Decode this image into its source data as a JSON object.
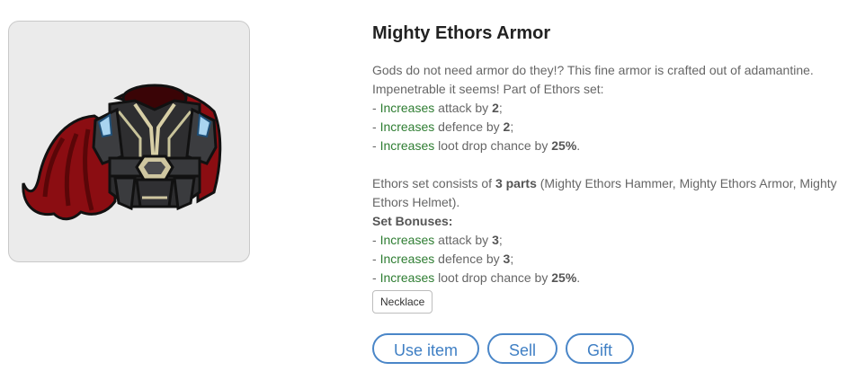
{
  "item": {
    "title": "Mighty Ethors Armor",
    "image_icon": "armor-icon"
  },
  "description": {
    "intro_line1": "Gods do not need armor do they!? This fine armor is crafted out of adamantine.",
    "intro_line2": "Impenetrable it seems! Part of Ethors set:",
    "bonuses": [
      {
        "prefix": "- ",
        "verb": "Increases",
        "text": " attack by ",
        "value": "2",
        "suffix": ";"
      },
      {
        "prefix": "- ",
        "verb": "Increases",
        "text": " defence by ",
        "value": "2",
        "suffix": ";"
      },
      {
        "prefix": "- ",
        "verb": "Increases",
        "text": " loot drop chance by ",
        "value": "25%",
        "suffix": "."
      }
    ],
    "set_text_before": "Ethors set consists of ",
    "set_parts": "3 parts",
    "set_text_after": " (Mighty Ethors Hammer, Mighty Ethors Armor, Mighty Ethors Helmet).",
    "set_bonuses_label": "Set Bonuses:",
    "set_bonuses": [
      {
        "prefix": "- ",
        "verb": "Increases",
        "text": " attack by ",
        "value": "3",
        "suffix": ";"
      },
      {
        "prefix": "- ",
        "verb": "Increases",
        "text": " defence by ",
        "value": "3",
        "suffix": ";"
      },
      {
        "prefix": "- ",
        "verb": "Increases",
        "text": " loot drop chance by ",
        "value": "25%",
        "suffix": "."
      }
    ]
  },
  "tag": {
    "label": "Necklace"
  },
  "actions": {
    "use_label": "Use item",
    "sell_label": "Sell",
    "gift_label": "Gift"
  },
  "colors": {
    "accent": "#4a86c8",
    "increase_green": "#2e7d32",
    "cape_red": "#8b0d12"
  }
}
